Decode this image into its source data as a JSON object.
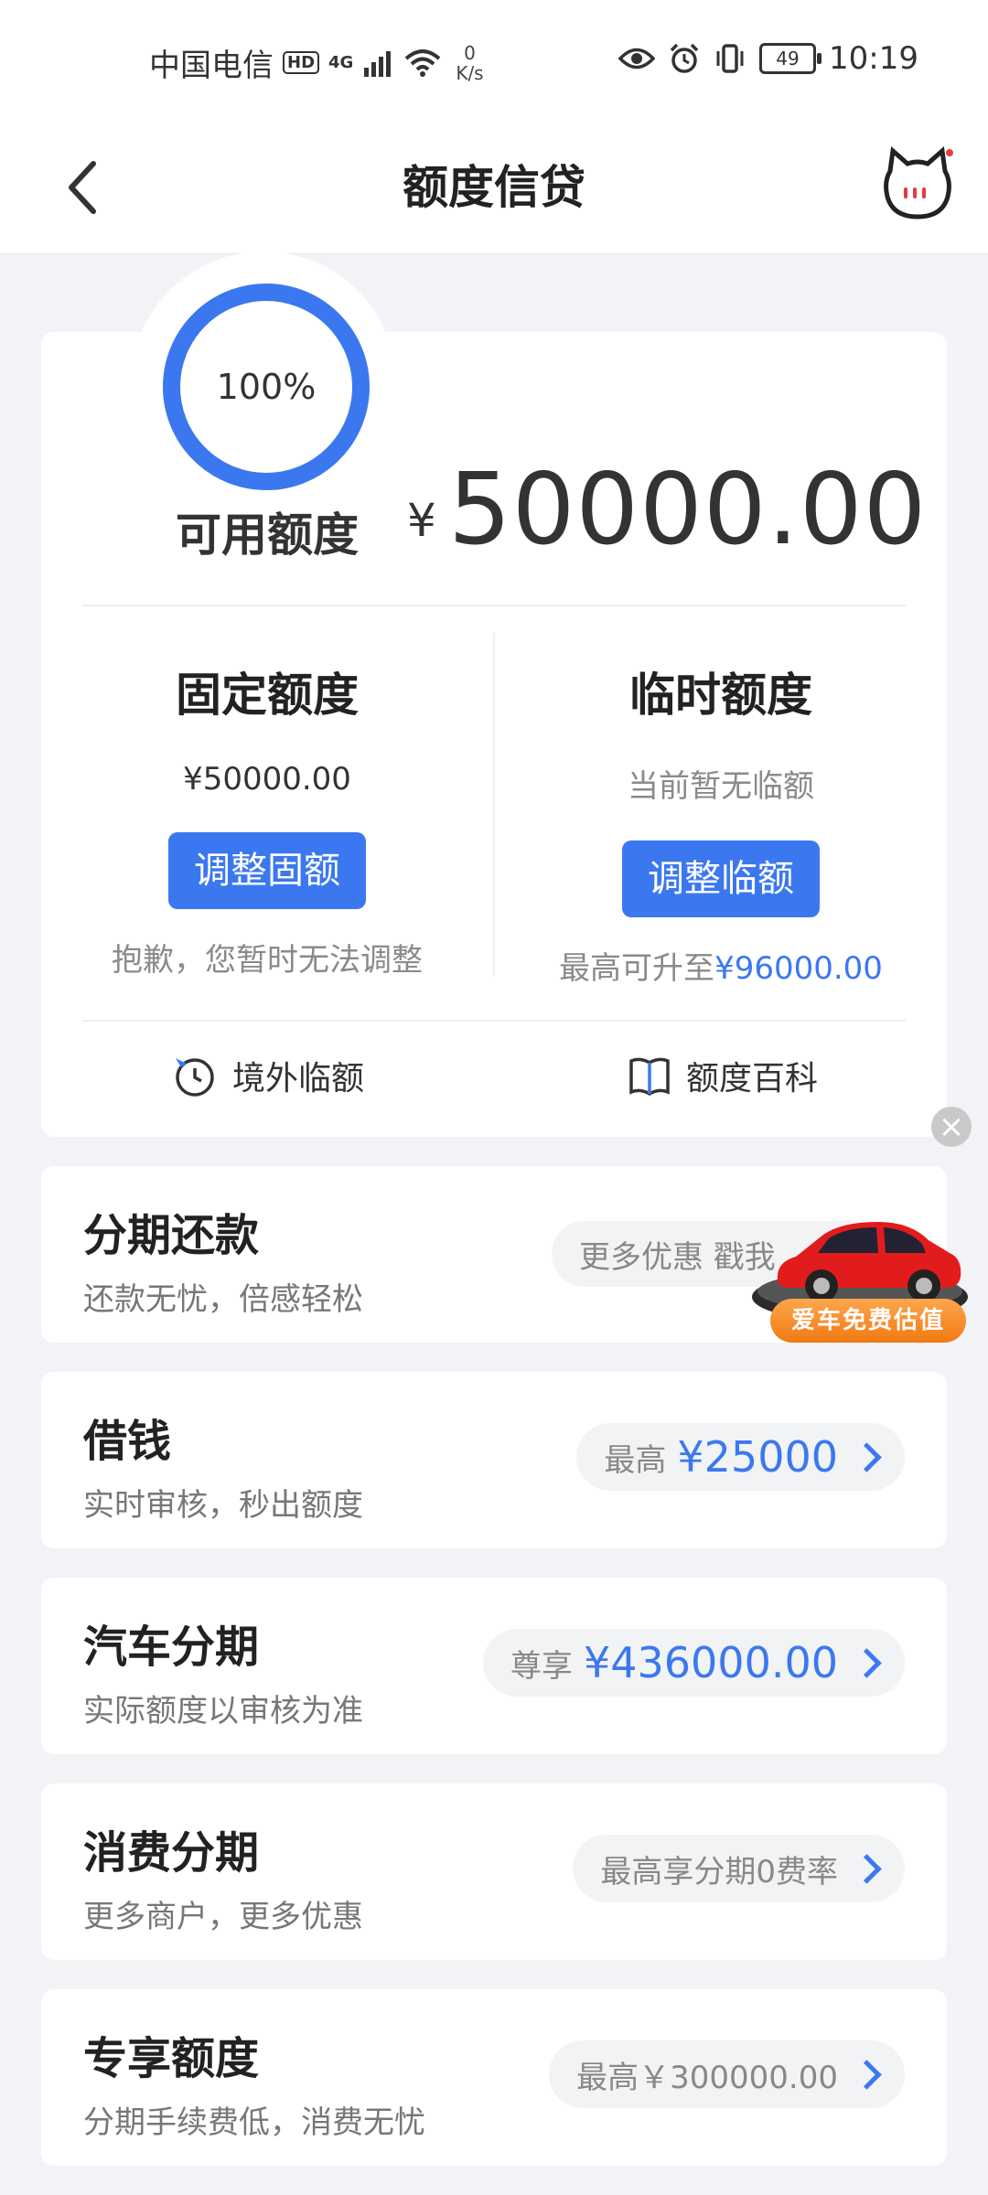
{
  "status_bar": {
    "carrier": "中国电信",
    "hd": "HD",
    "network": "4G",
    "speed_value": "0",
    "speed_unit": "K/s",
    "battery": "49",
    "time": "10:19"
  },
  "header": {
    "title": "额度信贷"
  },
  "credit": {
    "percent": "100%",
    "available_label": "可用额度",
    "currency_symbol": "¥",
    "available_amount": "50000.00",
    "fixed": {
      "title": "固定额度",
      "value": "¥50000.00",
      "button": "调整固额",
      "note": "抱歉，您暂时无法调整"
    },
    "temporary": {
      "title": "临时额度",
      "value": "当前暂无临额",
      "button": "调整临额",
      "note_prefix": "最高可升至",
      "note_amount": "¥96000.00"
    },
    "quick_links": [
      {
        "label": "境外临额",
        "icon": "clock-plane-icon"
      },
      {
        "label": "额度百科",
        "icon": "book-icon"
      }
    ]
  },
  "products": [
    {
      "title": "分期还款",
      "subtitle": "还款无忧，倍感轻松",
      "pill_text": "更多优惠 戳我",
      "pill_amount": ""
    },
    {
      "title": "借钱",
      "subtitle": "实时审核，秒出额度",
      "pill_text": "最高",
      "pill_amount": "¥25000"
    },
    {
      "title": "汽车分期",
      "subtitle": "实际额度以审核为准",
      "pill_text": "尊享",
      "pill_amount": "¥436000.00"
    },
    {
      "title": "消费分期",
      "subtitle": "更多商户，更多优惠",
      "pill_text": "最高享分期0费率",
      "pill_amount": ""
    },
    {
      "title": "专享额度",
      "subtitle": "分期手续费低，消费无忧",
      "pill_text": "最高￥300000.00",
      "pill_amount": ""
    }
  ],
  "ad": {
    "label": "爱车免费估值",
    "close": "×"
  },
  "colors": {
    "accent": "#3b78f0",
    "background": "#f2f3f7",
    "ad_orange": "#f07a12"
  }
}
